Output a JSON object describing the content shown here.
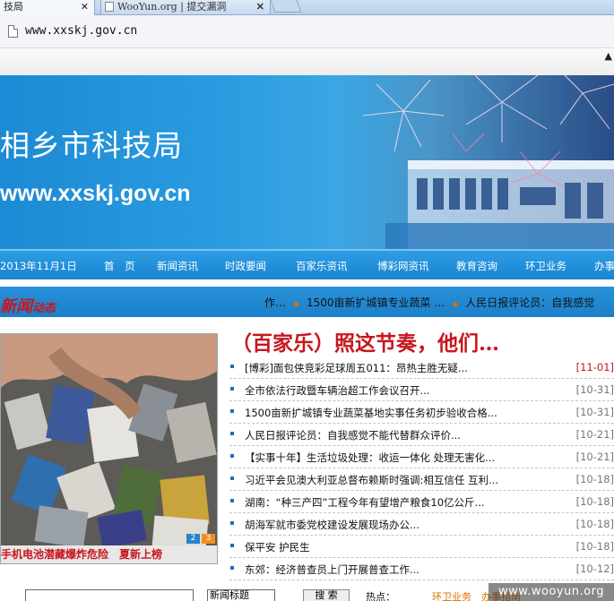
{
  "browser": {
    "tabs": [
      {
        "label": "技局",
        "active": true
      },
      {
        "label": "WooYun.org | 提交漏洞",
        "active": false
      }
    ],
    "close_glyph": "✕",
    "url": "www.xxskj.gov.cn"
  },
  "banner": {
    "title": "相乡市科技局",
    "url": "www.xxskj.gov.cn"
  },
  "nav": {
    "date": "2013年11月1日",
    "items": [
      "首　页",
      "新闻资讯",
      "时政要闻",
      "百家乐资讯",
      "博彩网资讯",
      "教育咨询",
      "环卫业务",
      "办事"
    ]
  },
  "news_bar": {
    "logo_main": "新闻",
    "logo_small": "动态",
    "ticker": [
      "作…",
      "1500亩新扩城镇专业蔬菜 …",
      "人民日报评论员：自我感觉"
    ]
  },
  "feature": {
    "caption": "手机电池潜藏爆炸危险　夏新上榜",
    "pager": [
      "2",
      "3"
    ]
  },
  "headline": "（百家乐）照这节奏，他们…",
  "news_list": [
    {
      "title": "[博彩]面包侠竞彩足球周五011：昂热主胜无疑...",
      "date": "[11-01]",
      "hot": true
    },
    {
      "title": "全市依法行政暨车辆治超工作会议召开...",
      "date": "[10-31]",
      "hot": false
    },
    {
      "title": "1500亩新扩城镇专业蔬菜基地实事任务初步验收合格...",
      "date": "[10-31]",
      "hot": false
    },
    {
      "title": "人民日报评论员：自我感觉不能代替群众评价...",
      "date": "[10-21]",
      "hot": false
    },
    {
      "title": "【实事十年】生活垃圾处理：收运一体化 处理无害化...",
      "date": "[10-21]",
      "hot": false
    },
    {
      "title": "习近平会见澳大利亚总督布赖斯时强调:相互信任 互利...",
      "date": "[10-18]",
      "hot": false
    },
    {
      "title": "湖南：“种三产四”工程今年有望增产粮食10亿公斤...",
      "date": "[10-18]",
      "hot": false
    },
    {
      "title": "胡海军就市委党校建设发展现场办公...",
      "date": "[10-18]",
      "hot": false
    },
    {
      "title": "保平安 护民生",
      "date": "[10-18]",
      "hot": false
    },
    {
      "title": "东郊：经济普查员上门开展普查工作...",
      "date": "[10-12]",
      "hot": false
    }
  ],
  "search": {
    "select_value": "新闻标题",
    "button": "搜 索",
    "hot_label": "热点：",
    "hot_links": "环卫业务　办事指南"
  },
  "watermark": "www.wooyun.org",
  "colors": {
    "nav_blue": "#1a83cf",
    "headline_red": "#c8161d",
    "link_orange": "#e26a00"
  }
}
